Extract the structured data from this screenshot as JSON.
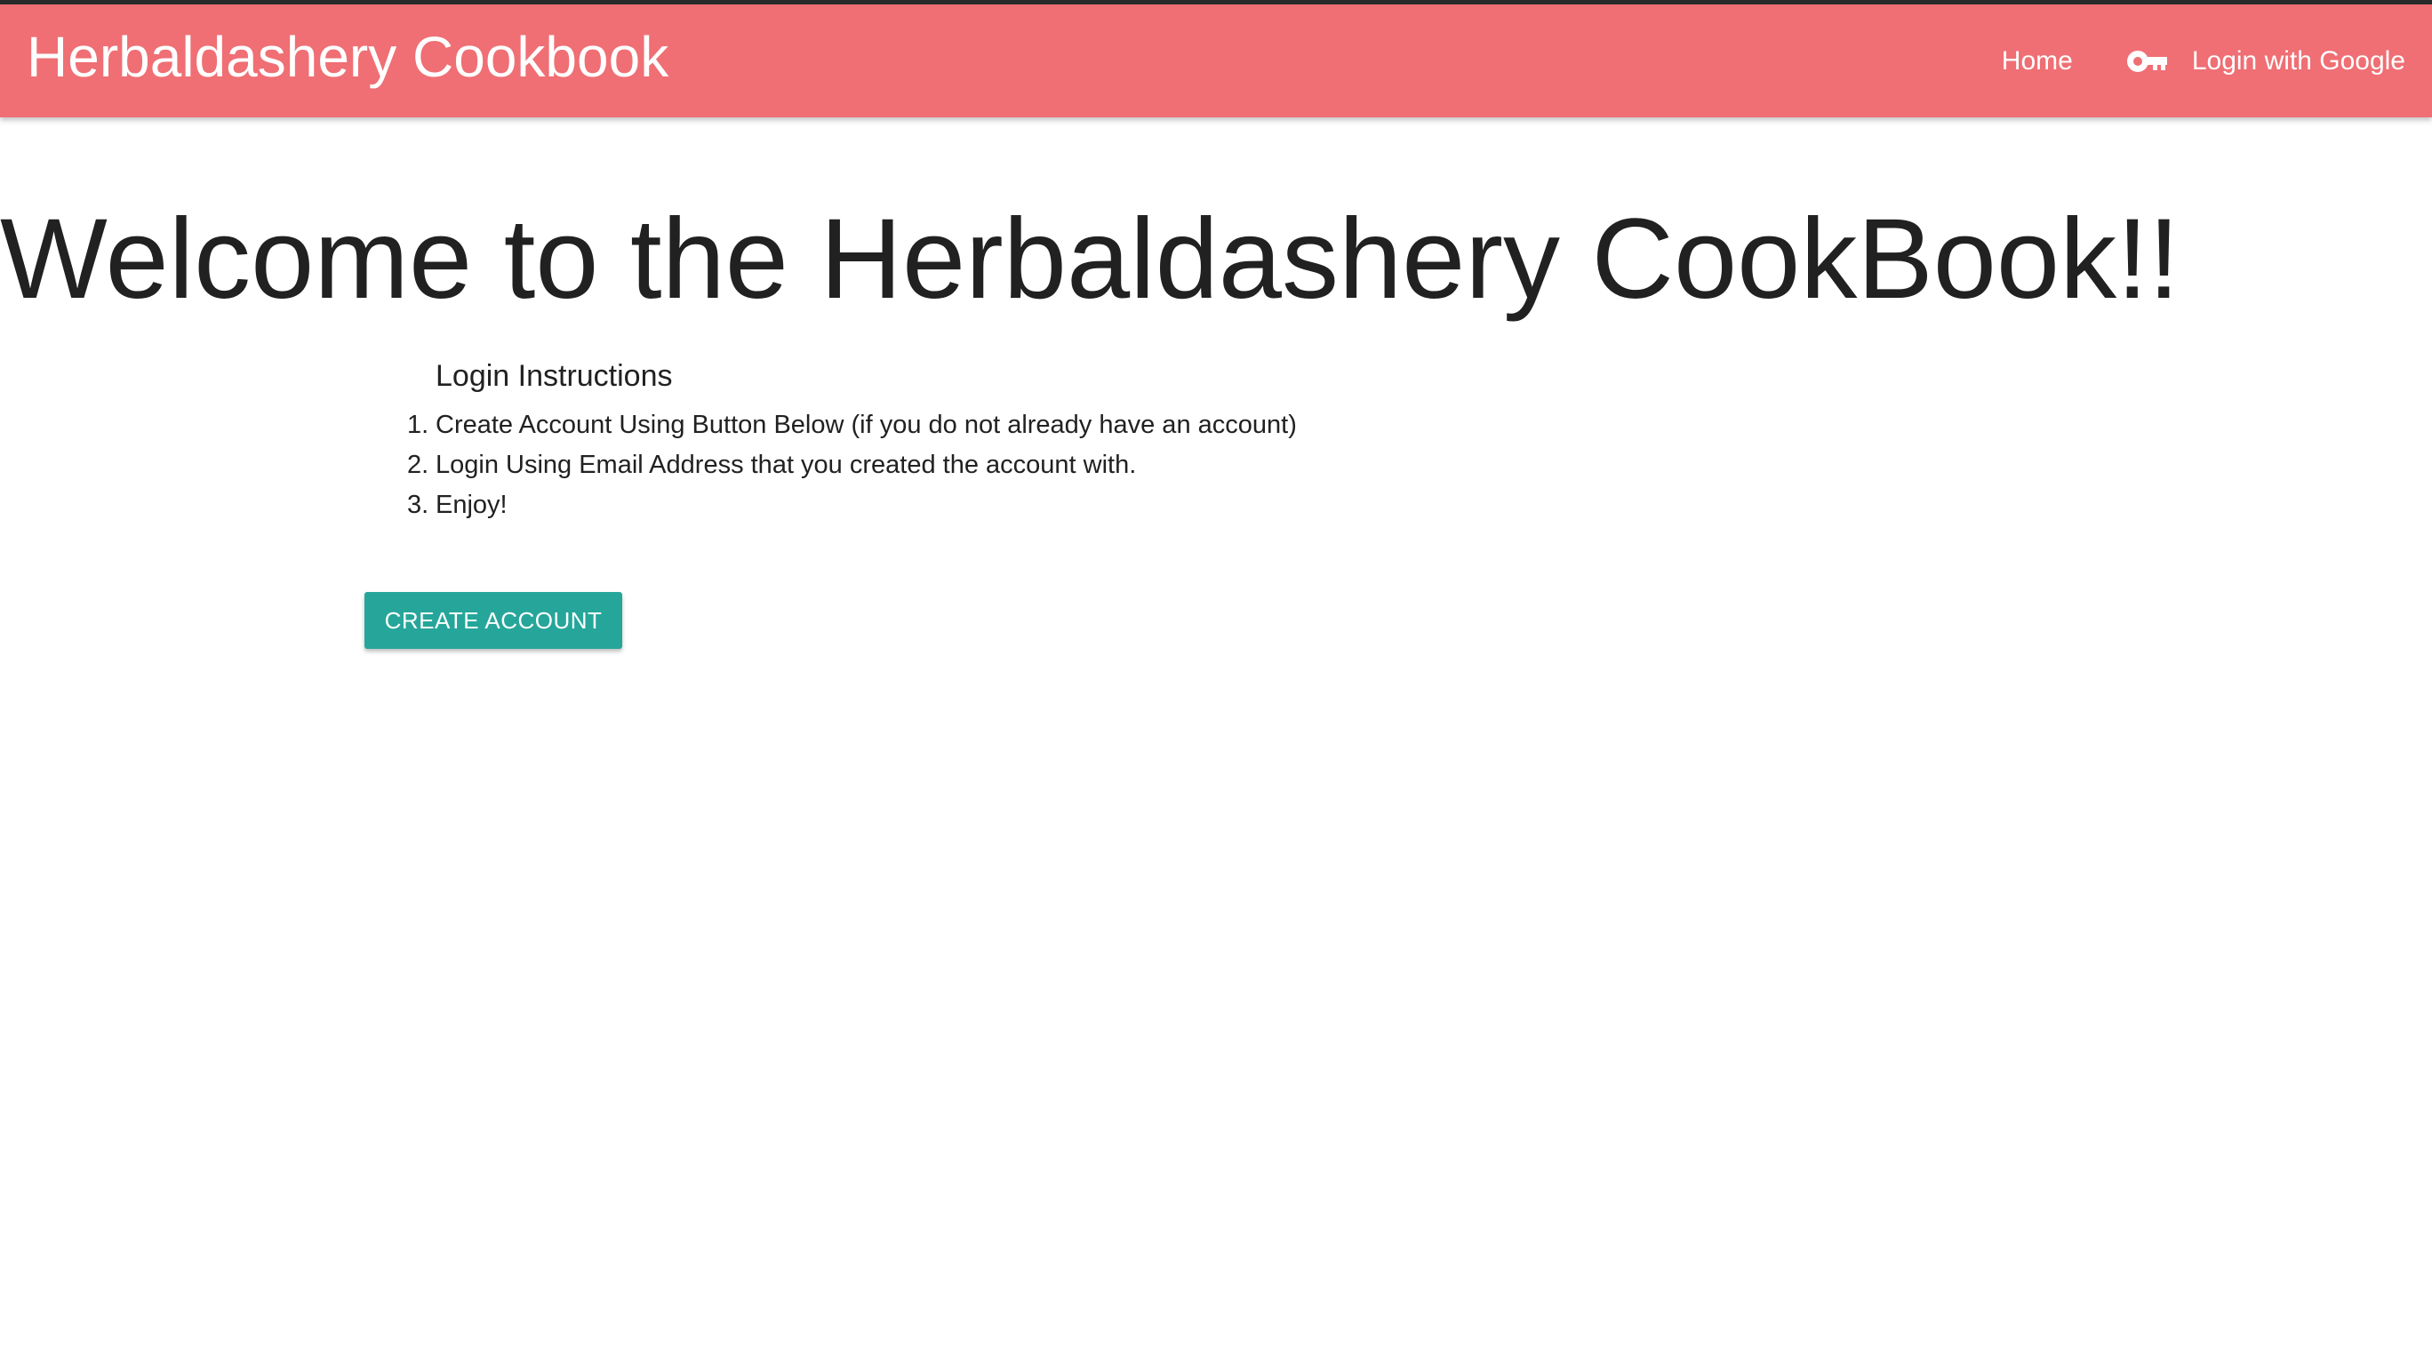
{
  "header": {
    "brand": "Herbaldashery Cookbook",
    "nav": {
      "home": "Home",
      "login": "Login with Google",
      "login_icon": "key-icon"
    }
  },
  "main": {
    "welcome": "Welcome to the Herbaldashery CookBook!!",
    "instructions": {
      "title": "Login Instructions",
      "steps": [
        {
          "num": "1.",
          "text": "Create Account Using Button Below (if you do not already have an account)"
        },
        {
          "num": "2.",
          "text": "Login Using Email Address that you created the account with."
        },
        {
          "num": "3.",
          "text": "Enjoy!"
        }
      ]
    },
    "create_account_label": "CREATE ACCOUNT"
  },
  "colors": {
    "navbar": "#ef6f74",
    "button": "#26a69a",
    "text": "#212121"
  }
}
